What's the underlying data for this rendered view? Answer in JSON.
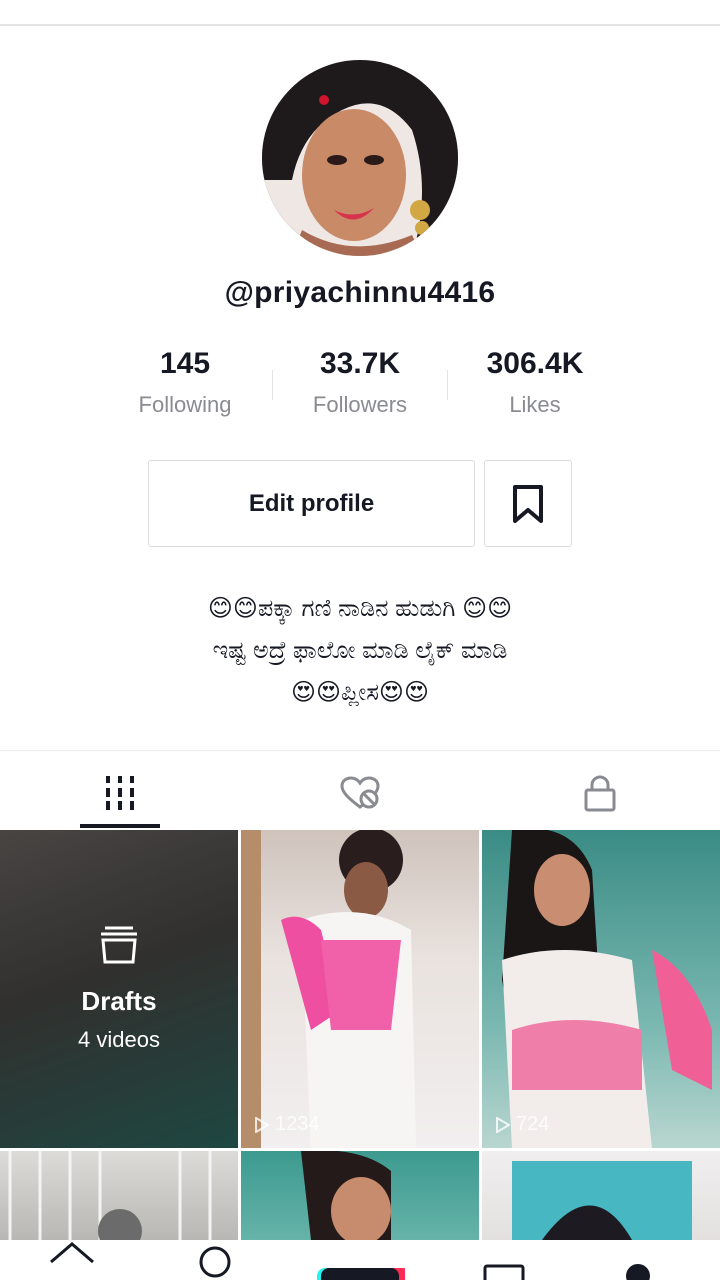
{
  "profile": {
    "username": "@priyachinnu4416",
    "stats": [
      {
        "value": "145",
        "label": "Following"
      },
      {
        "value": "33.7K",
        "label": "Followers"
      },
      {
        "value": "306.4K",
        "label": "Likes"
      }
    ],
    "edit_label": "Edit profile",
    "bio": [
      "😊😊ಪಕ್ಕಾ ಗಣಿ ನಾಡಿನ ಹುಡುಗಿ 😊😊",
      "ಇಷ್ಟ ಅದ್ರೆ ಫಾಲೋ ಮಾಡಿ  ಲೈಕ್ ಮಾಡಿ",
      "😍😍ಪ್ಲೀಸ😍😍"
    ]
  },
  "tabs": [
    {
      "icon": "grid-icon",
      "active": true
    },
    {
      "icon": "liked-hidden-icon",
      "active": false
    },
    {
      "icon": "lock-icon",
      "active": false
    }
  ],
  "videos": {
    "drafts": {
      "title": "Drafts",
      "count": "4 videos"
    },
    "views": [
      "1234",
      "724"
    ]
  },
  "nav": [
    "home-icon",
    "discover-icon",
    "create-icon",
    "inbox-icon",
    "profile-icon"
  ],
  "colors": {
    "text": "#161823",
    "muted": "#8a8b91",
    "border": "#dcdcde"
  }
}
